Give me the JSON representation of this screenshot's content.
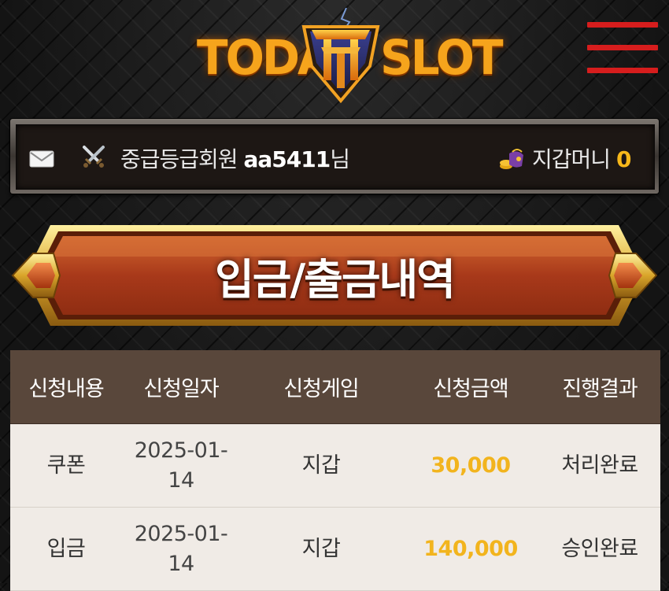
{
  "header": {
    "logo_left": "TODAY",
    "logo_right": "SLOT",
    "menu_icon": "hamburger-icon"
  },
  "userbar": {
    "mail_icon": "mail-icon",
    "grade_icon": "crossed-swords-icon",
    "grade_label": "중급등급회원",
    "username": "aa5411",
    "honorific": "님",
    "wallet_icon": "wallet-coins-icon",
    "wallet_label": "지갑머니",
    "wallet_amount": "0"
  },
  "page_title": "입금/출금내역",
  "table": {
    "headers": [
      "신청내용",
      "신청일자",
      "신청게임",
      "신청금액",
      "진행결과"
    ],
    "rows": [
      {
        "type": "쿠폰",
        "date": "2025-01-14",
        "game": "지갑",
        "amount": "30,000",
        "status": "처리완료"
      },
      {
        "type": "입금",
        "date": "2025-01-14",
        "game": "지갑",
        "amount": "140,000",
        "status": "승인완료"
      }
    ]
  },
  "colors": {
    "accent_gold": "#f7b81a",
    "menu_red": "#d61d1d",
    "banner_orange": "#b3421b",
    "table_header": "#59473b",
    "table_row": "#f0ebe6"
  }
}
